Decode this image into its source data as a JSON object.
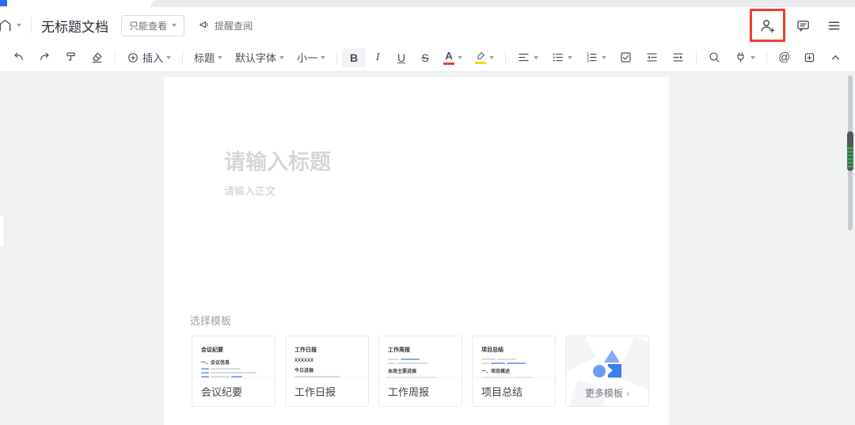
{
  "window": {
    "tab_accent_color": "#2f6bf0"
  },
  "header": {
    "title": "无标题文档",
    "permission_badge": "只能查看",
    "remind_review": "提醒查阅"
  },
  "toolbar": {
    "insert": "插入",
    "paragraph_style": "标题",
    "font_family": "默认字体",
    "font_size": "小一",
    "bold": "B",
    "italic": "I",
    "underline": "U",
    "strikethrough": "S",
    "font_color": "A",
    "mention": "@"
  },
  "editor": {
    "title_placeholder": "请输入标题",
    "body_placeholder": "请输入正文"
  },
  "templates": {
    "heading": "选择模板",
    "cards": [
      {
        "label": "会议纪要",
        "preview_title": "会议纪要",
        "preview_section": "一、会议信息"
      },
      {
        "label": "工作日报",
        "preview_title": "工作日报",
        "preview_sub": "XXXXXX",
        "preview_section": "今日进展"
      },
      {
        "label": "工作周报",
        "preview_title": "工作周报",
        "preview_section": "本周主要进展"
      },
      {
        "label": "项目总结",
        "preview_title": "项目总结",
        "preview_section": "一、项目概述"
      },
      {
        "label": "更多模板",
        "arrow": "›"
      }
    ]
  },
  "colors": {
    "annotation_red": "#f23c30",
    "template_blue": "#6d9bf3",
    "scrollbar_green": "#2fae53",
    "font_color_red": "#e23c2f",
    "highlight_yellow": "#f5d90a"
  }
}
